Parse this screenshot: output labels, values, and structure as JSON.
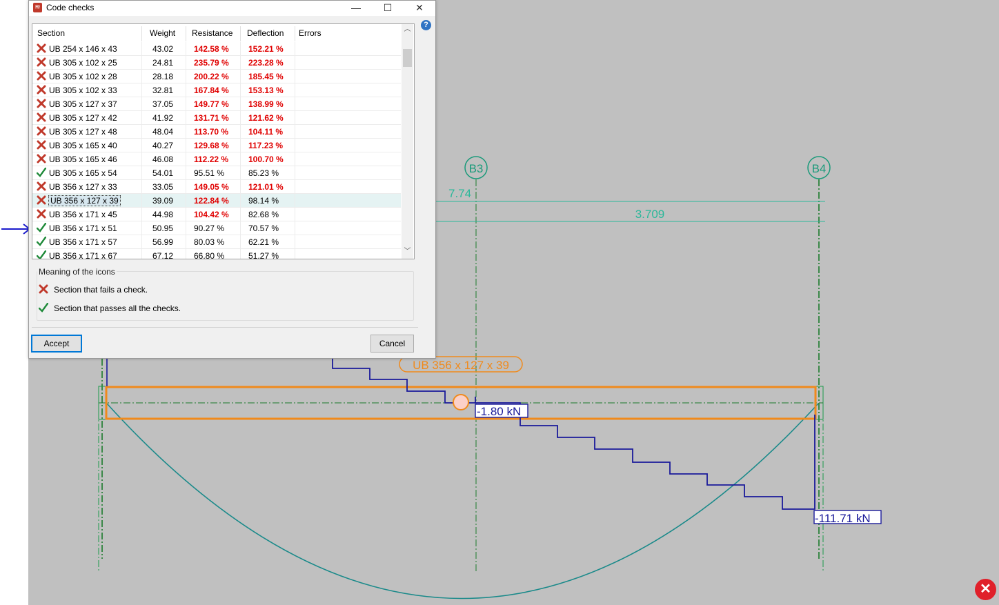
{
  "dialog": {
    "title": "Code checks",
    "columns": [
      "Section",
      "Weight",
      "Resistance",
      "Deflection",
      "Errors"
    ],
    "rows": [
      {
        "status": "fail",
        "section": "UB 254 x 146 x 43",
        "weight": "43.02",
        "resistance": "142.58 %",
        "resistance_fail": true,
        "deflection": "152.21 %",
        "deflection_fail": true
      },
      {
        "status": "fail",
        "section": "UB 305 x 102 x 25",
        "weight": "24.81",
        "resistance": "235.79 %",
        "resistance_fail": true,
        "deflection": "223.28 %",
        "deflection_fail": true
      },
      {
        "status": "fail",
        "section": "UB 305 x 102 x 28",
        "weight": "28.18",
        "resistance": "200.22 %",
        "resistance_fail": true,
        "deflection": "185.45 %",
        "deflection_fail": true
      },
      {
        "status": "fail",
        "section": "UB 305 x 102 x 33",
        "weight": "32.81",
        "resistance": "167.84 %",
        "resistance_fail": true,
        "deflection": "153.13 %",
        "deflection_fail": true
      },
      {
        "status": "fail",
        "section": "UB 305 x 127 x 37",
        "weight": "37.05",
        "resistance": "149.77 %",
        "resistance_fail": true,
        "deflection": "138.99 %",
        "deflection_fail": true
      },
      {
        "status": "fail",
        "section": "UB 305 x 127 x 42",
        "weight": "41.92",
        "resistance": "131.71 %",
        "resistance_fail": true,
        "deflection": "121.62 %",
        "deflection_fail": true
      },
      {
        "status": "fail",
        "section": "UB 305 x 127 x 48",
        "weight": "48.04",
        "resistance": "113.70 %",
        "resistance_fail": true,
        "deflection": "104.11 %",
        "deflection_fail": true
      },
      {
        "status": "fail",
        "section": "UB 305 x 165 x 40",
        "weight": "40.27",
        "resistance": "129.68 %",
        "resistance_fail": true,
        "deflection": "117.23 %",
        "deflection_fail": true
      },
      {
        "status": "fail",
        "section": "UB 305 x 165 x 46",
        "weight": "46.08",
        "resistance": "112.22 %",
        "resistance_fail": true,
        "deflection": "100.70 %",
        "deflection_fail": true
      },
      {
        "status": "pass",
        "section": "UB 305 x 165 x 54",
        "weight": "54.01",
        "resistance": "95.51 %",
        "resistance_fail": false,
        "deflection": "85.23 %",
        "deflection_fail": false
      },
      {
        "status": "fail",
        "section": "UB 356 x 127 x 33",
        "weight": "33.05",
        "resistance": "149.05 %",
        "resistance_fail": true,
        "deflection": "121.01 %",
        "deflection_fail": true
      },
      {
        "status": "fail",
        "section": "UB 356 x 127 x 39",
        "weight": "39.09",
        "resistance": "122.84 %",
        "resistance_fail": true,
        "deflection": "98.14 %",
        "deflection_fail": false,
        "selected": true
      },
      {
        "status": "fail",
        "section": "UB 356 x 171 x 45",
        "weight": "44.98",
        "resistance": "104.42 %",
        "resistance_fail": true,
        "deflection": "82.68 %",
        "deflection_fail": false
      },
      {
        "status": "pass",
        "section": "UB 356 x 171 x 51",
        "weight": "50.95",
        "resistance": "90.27 %",
        "resistance_fail": false,
        "deflection": "70.57 %",
        "deflection_fail": false
      },
      {
        "status": "pass",
        "section": "UB 356 x 171 x 57",
        "weight": "56.99",
        "resistance": "80.03 %",
        "resistance_fail": false,
        "deflection": "62.21 %",
        "deflection_fail": false
      },
      {
        "status": "pass",
        "section": "UB 356 x 171 x 67",
        "weight": "67.12",
        "resistance": "66.80 %",
        "resistance_fail": false,
        "deflection": "51.27 %",
        "deflection_fail": false
      }
    ],
    "legend": {
      "title": "Meaning of the icons",
      "fail_text": "Section that fails a check.",
      "pass_text": "Section that passes all the checks."
    },
    "accept_label": "Accept",
    "cancel_label": "Cancel",
    "help_label": "?"
  },
  "drawing": {
    "axis_b3": "B3",
    "axis_b4": "B4",
    "dim_left": "7.74",
    "dim_span": "3.709",
    "beam_label": "UB 356 x 127 x 39",
    "shear_mid_label": "-1.80 kN",
    "shear_end_label": "-111.71 kN"
  },
  "icons": {
    "fail": "red-cross-icon",
    "pass": "green-check-icon",
    "close": "close-red-icon"
  },
  "colors": {
    "fail_text": "#e00000",
    "pass_icon": "#1f8a3a",
    "beam_highlight": "#f08a1c",
    "axis_line": "#1a9a7a",
    "shear_diagram": "#1a1a9a",
    "moment_diagram": "#1a8a8a"
  }
}
